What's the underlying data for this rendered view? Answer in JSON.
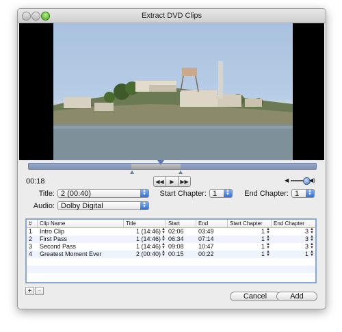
{
  "window": {
    "title": "Extract DVD Clips"
  },
  "player": {
    "current_time": "00:18"
  },
  "form": {
    "title_label": "Title:",
    "title_value": "2 (00:40)",
    "start_chapter_label": "Start Chapter:",
    "start_chapter_value": "1",
    "end_chapter_label": "End Chapter:",
    "end_chapter_value": "1",
    "audio_label": "Audio:",
    "audio_value": "Dolby Digital"
  },
  "table": {
    "columns": [
      "#",
      "Clip Name",
      "Title",
      "Start",
      "End",
      "Start Chapter",
      "End Chapter"
    ],
    "rows": [
      {
        "num": "1",
        "name": "Intro Clip",
        "title": "1 (14:46)",
        "start": "02:06",
        "end": "03:49",
        "start_chapter": "1",
        "end_chapter": "3"
      },
      {
        "num": "2",
        "name": "First Pass",
        "title": "1 (14:46)",
        "start": "06:34",
        "end": "07:14",
        "start_chapter": "1",
        "end_chapter": "3"
      },
      {
        "num": "3",
        "name": "Second Pass",
        "title": "1 (14:46)",
        "start": "09:08",
        "end": "10:47",
        "start_chapter": "1",
        "end_chapter": "3"
      },
      {
        "num": "4",
        "name": "Greatest Moment Ever",
        "title": "2 (00:40)",
        "start": "00:15",
        "end": "00:22",
        "start_chapter": "1",
        "end_chapter": "1"
      }
    ]
  },
  "buttons": {
    "add_row": "+",
    "remove_row": "−",
    "cancel": "Cancel",
    "add": "Add"
  },
  "icons": {
    "rewind": "rewind-icon",
    "play": "play-icon",
    "forward": "fast-forward-icon",
    "volume_low": "speaker-low-icon",
    "volume_high": "speaker-high-icon"
  },
  "colors": {
    "accent": "#3d6fc8",
    "scrubber": "#8a9bbd",
    "selection_border": "#86a7d8"
  }
}
